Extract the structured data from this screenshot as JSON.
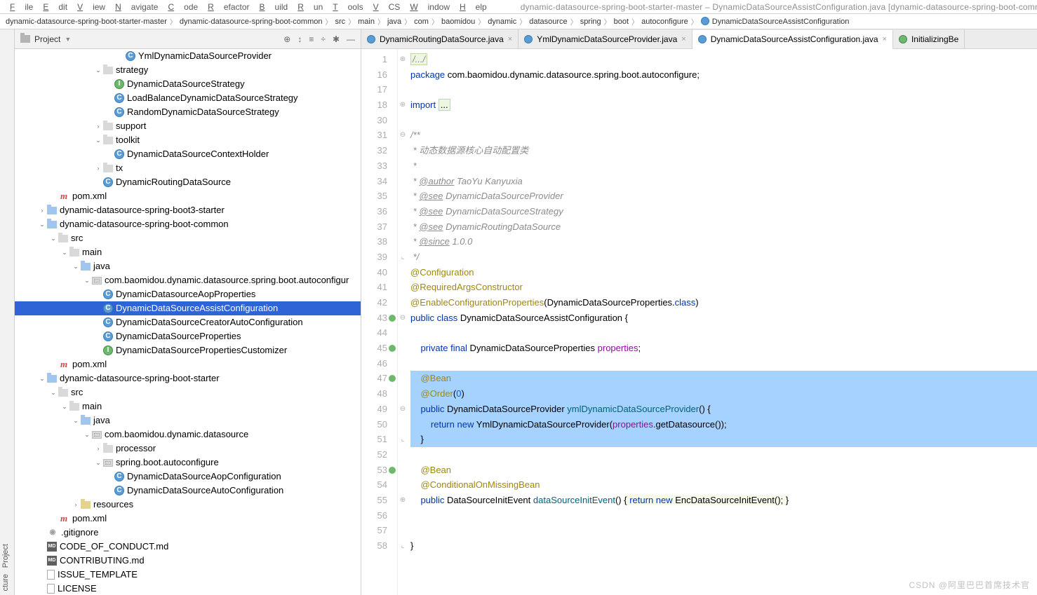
{
  "menu": {
    "items": [
      "File",
      "Edit",
      "View",
      "Navigate",
      "Code",
      "Refactor",
      "Build",
      "Run",
      "Tools",
      "VCS",
      "Window",
      "Help"
    ],
    "title": "dynamic-datasource-spring-boot-starter-master – DynamicDataSourceAssistConfiguration.java [dynamic-datasource-spring-boot-comm…"
  },
  "breadcrumb": [
    "dynamic-datasource-spring-boot-starter-master",
    "dynamic-datasource-spring-boot-common",
    "src",
    "main",
    "java",
    "com",
    "baomidou",
    "dynamic",
    "datasource",
    "spring",
    "boot",
    "autoconfigure",
    "DynamicDataSourceAssistConfiguration"
  ],
  "sidebar": {
    "project_label": "Project",
    "structure_label": "cture"
  },
  "project_toolbar": {
    "title": "Project",
    "icons": [
      "⊕",
      "↕",
      "≡",
      "÷",
      "✱",
      "—"
    ]
  },
  "tree": [
    {
      "d": 9,
      "i": "cls",
      "t": "YmlDynamicDataSourceProvider"
    },
    {
      "d": 7,
      "a": "v",
      "i": "folder",
      "t": "strategy"
    },
    {
      "d": 8,
      "i": "intf",
      "t": "DynamicDataSourceStrategy"
    },
    {
      "d": 8,
      "i": "cls",
      "t": "LoadBalanceDynamicDataSourceStrategy"
    },
    {
      "d": 8,
      "i": "cls",
      "t": "RandomDynamicDataSourceStrategy"
    },
    {
      "d": 7,
      "a": ">",
      "i": "folder",
      "t": "support"
    },
    {
      "d": 7,
      "a": "v",
      "i": "folder",
      "t": "toolkit"
    },
    {
      "d": 8,
      "i": "cls",
      "t": "DynamicDataSourceContextHolder"
    },
    {
      "d": 7,
      "a": ">",
      "i": "folder",
      "t": "tx"
    },
    {
      "d": 7,
      "i": "cls",
      "t": "DynamicRoutingDataSource"
    },
    {
      "d": 3,
      "i": "mvn",
      "t": "pom.xml"
    },
    {
      "d": 2,
      "a": ">",
      "i": "folder-src",
      "t": "dynamic-datasource-spring-boot3-starter"
    },
    {
      "d": 2,
      "a": "v",
      "i": "folder-src",
      "t": "dynamic-datasource-spring-boot-common"
    },
    {
      "d": 3,
      "a": "v",
      "i": "folder",
      "t": "src"
    },
    {
      "d": 4,
      "a": "v",
      "i": "folder",
      "t": "main"
    },
    {
      "d": 5,
      "a": "v",
      "i": "folder-src",
      "t": "java"
    },
    {
      "d": 6,
      "a": "v",
      "i": "pkg",
      "t": "com.baomidou.dynamic.datasource.spring.boot.autoconfigur"
    },
    {
      "d": 7,
      "i": "cls",
      "t": "DynamicDatasourceAopProperties"
    },
    {
      "d": 7,
      "i": "cls",
      "t": "DynamicDataSourceAssistConfiguration",
      "sel": true
    },
    {
      "d": 7,
      "i": "cls",
      "t": "DynamicDataSourceCreatorAutoConfiguration"
    },
    {
      "d": 7,
      "i": "cls",
      "t": "DynamicDataSourceProperties"
    },
    {
      "d": 7,
      "i": "intf",
      "t": "DynamicDataSourcePropertiesCustomizer"
    },
    {
      "d": 3,
      "i": "mvn",
      "t": "pom.xml"
    },
    {
      "d": 2,
      "a": "v",
      "i": "folder-src",
      "t": "dynamic-datasource-spring-boot-starter"
    },
    {
      "d": 3,
      "a": "v",
      "i": "folder",
      "t": "src"
    },
    {
      "d": 4,
      "a": "v",
      "i": "folder",
      "t": "main"
    },
    {
      "d": 5,
      "a": "v",
      "i": "folder-src",
      "t": "java"
    },
    {
      "d": 6,
      "a": "v",
      "i": "pkg",
      "t": "com.baomidou.dynamic.datasource"
    },
    {
      "d": 7,
      "a": ">",
      "i": "folder",
      "t": "processor"
    },
    {
      "d": 7,
      "a": "v",
      "i": "pkg",
      "t": "spring.boot.autoconfigure"
    },
    {
      "d": 8,
      "i": "cls",
      "t": "DynamicDataSourceAopConfiguration"
    },
    {
      "d": 8,
      "i": "cls",
      "t": "DynamicDataSourceAutoConfiguration"
    },
    {
      "d": 5,
      "a": ">",
      "i": "folder-res",
      "t": "resources"
    },
    {
      "d": 3,
      "i": "mvn",
      "t": "pom.xml"
    },
    {
      "d": 2,
      "i": "git",
      "t": ".gitignore"
    },
    {
      "d": 2,
      "i": "md",
      "t": "CODE_OF_CONDUCT.md"
    },
    {
      "d": 2,
      "i": "md",
      "t": "CONTRIBUTING.md"
    },
    {
      "d": 2,
      "i": "txt",
      "t": "ISSUE_TEMPLATE"
    },
    {
      "d": 2,
      "i": "txt",
      "t": "LICENSE"
    }
  ],
  "tabs": [
    {
      "icon": "blue",
      "label": "DynamicRoutingDataSource.java",
      "active": false
    },
    {
      "icon": "blue",
      "label": "YmlDynamicDataSourceProvider.java",
      "active": false
    },
    {
      "icon": "blue",
      "label": "DynamicDataSourceAssistConfiguration.java",
      "active": true
    },
    {
      "icon": "green",
      "label": "InitializingBe",
      "active": false,
      "nocross": true
    }
  ],
  "code": {
    "start_line": 1,
    "lines": [
      {
        "n": 1,
        "f": "⊕",
        "html": "<span class='com box'>/.../</span>"
      },
      {
        "n": 16,
        "html": "<span class='kw'>package</span> com.baomidou.dynamic.datasource.spring.boot.autoconfigure;"
      },
      {
        "n": 17,
        "html": ""
      },
      {
        "n": 18,
        "f": "⊕",
        "html": "<span class='kw'>import</span> <span class='box'>...</span>"
      },
      {
        "n": 30,
        "html": ""
      },
      {
        "n": 31,
        "f": "⊖",
        "html": "<span class='doc'>/**</span>"
      },
      {
        "n": 32,
        "html": "<span class='doc'> * 动态数据源核心自动配置类</span>"
      },
      {
        "n": 33,
        "html": "<span class='doc'> *</span>"
      },
      {
        "n": 34,
        "html": "<span class='doc'> * <span class='doctag'>@author</span> TaoYu Kanyuxia</span>"
      },
      {
        "n": 35,
        "html": "<span class='doc'> * <span class='doctag'>@see</span> DynamicDataSourceProvider</span>"
      },
      {
        "n": 36,
        "html": "<span class='doc'> * <span class='doctag'>@see</span> DynamicDataSourceStrategy</span>"
      },
      {
        "n": 37,
        "html": "<span class='doc'> * <span class='doctag'>@see</span> DynamicRoutingDataSource</span>"
      },
      {
        "n": 38,
        "html": "<span class='doc'> * <span class='doctag'>@since</span> 1.0.0</span>"
      },
      {
        "n": 39,
        "f": "⌞",
        "html": "<span class='doc'> */</span>"
      },
      {
        "n": 40,
        "html": "<span class='ann'>@Configuration</span>"
      },
      {
        "n": 41,
        "html": "<span class='ann'>@RequiredArgsConstructor</span>"
      },
      {
        "n": 42,
        "html": "<span class='ann'>@EnableConfigurationProperties</span>(DynamicDataSourceProperties.<span class='kw'>class</span>)"
      },
      {
        "n": 43,
        "m": true,
        "f": "⊖",
        "html": "<span class='kw'>public class</span> DynamicDataSourceAssistConfiguration {"
      },
      {
        "n": 44,
        "html": ""
      },
      {
        "n": 45,
        "m": true,
        "html": "    <span class='kw'>private final</span> DynamicDataSourceProperties <span class='fld-c'>properties</span>;"
      },
      {
        "n": 46,
        "html": ""
      },
      {
        "n": 47,
        "m": true,
        "hl": true,
        "html": "    <span class='ann'>@Bean</span>"
      },
      {
        "n": 48,
        "hl": true,
        "html": "    <span class='ann'>@Order</span>(<span class='num'>0</span>)"
      },
      {
        "n": 49,
        "f": "⊖",
        "hl": true,
        "html": "    <span class='kw'>public</span> DynamicDataSourceProvider <span class='meth'>ymlDynamicDataSourceProvider</span>() {"
      },
      {
        "n": 50,
        "hl": true,
        "html": "        <span class='kw'>return new</span> YmlDynamicDataSourceProvider(<span class='fld-c'>properties</span>.getDatasource());"
      },
      {
        "n": 51,
        "f": "⌞",
        "hl": true,
        "html": "    }"
      },
      {
        "n": 52,
        "html": ""
      },
      {
        "n": 53,
        "m": true,
        "html": "    <span class='ann'>@Bean</span>"
      },
      {
        "n": 54,
        "html": "    <span class='ann'>@ConditionalOnMissingBean</span>"
      },
      {
        "n": 55,
        "f": "⊕",
        "html": "    <span class='kw'>public</span> DataSourceInitEvent <span class='meth'>dataSourceInitEvent</span>() <span class='yellowbox'>{ <span class='kw'>return new</span> EncDataSourceInitEvent(); }</span>"
      },
      {
        "n": 56,
        "html": ""
      },
      {
        "n": 57,
        "html": ""
      },
      {
        "n": 58,
        "f": "⌞",
        "html": "}"
      }
    ]
  },
  "watermark": "CSDN @阿里巴巴首席技术官"
}
